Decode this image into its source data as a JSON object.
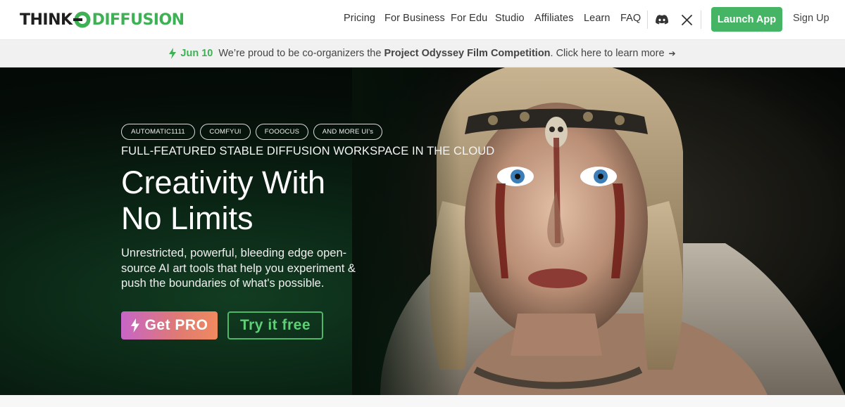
{
  "nav": {
    "logo": {
      "think": "THINK",
      "diffusion": "DIFFUSION"
    },
    "links": [
      "Pricing",
      "For Business",
      "For Edu",
      "Studio",
      "Affiliates",
      "Learn",
      "FAQ"
    ],
    "icons": [
      "discord-icon",
      "x-twitter-icon"
    ],
    "launch_label": "Launch App",
    "signup_label": "Sign Up"
  },
  "announcement": {
    "date": "Jun 10",
    "text_before": "We’re proud to be co-organizers the",
    "highlight": "Project Odyssey Film Competition",
    "text_after": ". Click here to learn more",
    "arrow": "➔"
  },
  "hero": {
    "tags": [
      "AUTOMATIC1111",
      "COMFYUI",
      "FOOOCUS",
      "AND MORE UI's"
    ],
    "tagline": "FULL-FEATURED STABLE DIFFUSION WORKSPACE IN THE CLOUD",
    "headline_line1": "Creativity With",
    "headline_line2": "No Limits",
    "description": "Unrestricted, powerful, bleeding edge open-source AI art tools that help you experiment & push the boundaries of what's possible.",
    "pro_label": "Get PRO",
    "free_label": "Try it free"
  },
  "colors": {
    "brand_green": "#46b465",
    "hero_bg": "#050d08",
    "pro_gradient_start": "#c765c8",
    "pro_gradient_end": "#ef8a5f"
  }
}
